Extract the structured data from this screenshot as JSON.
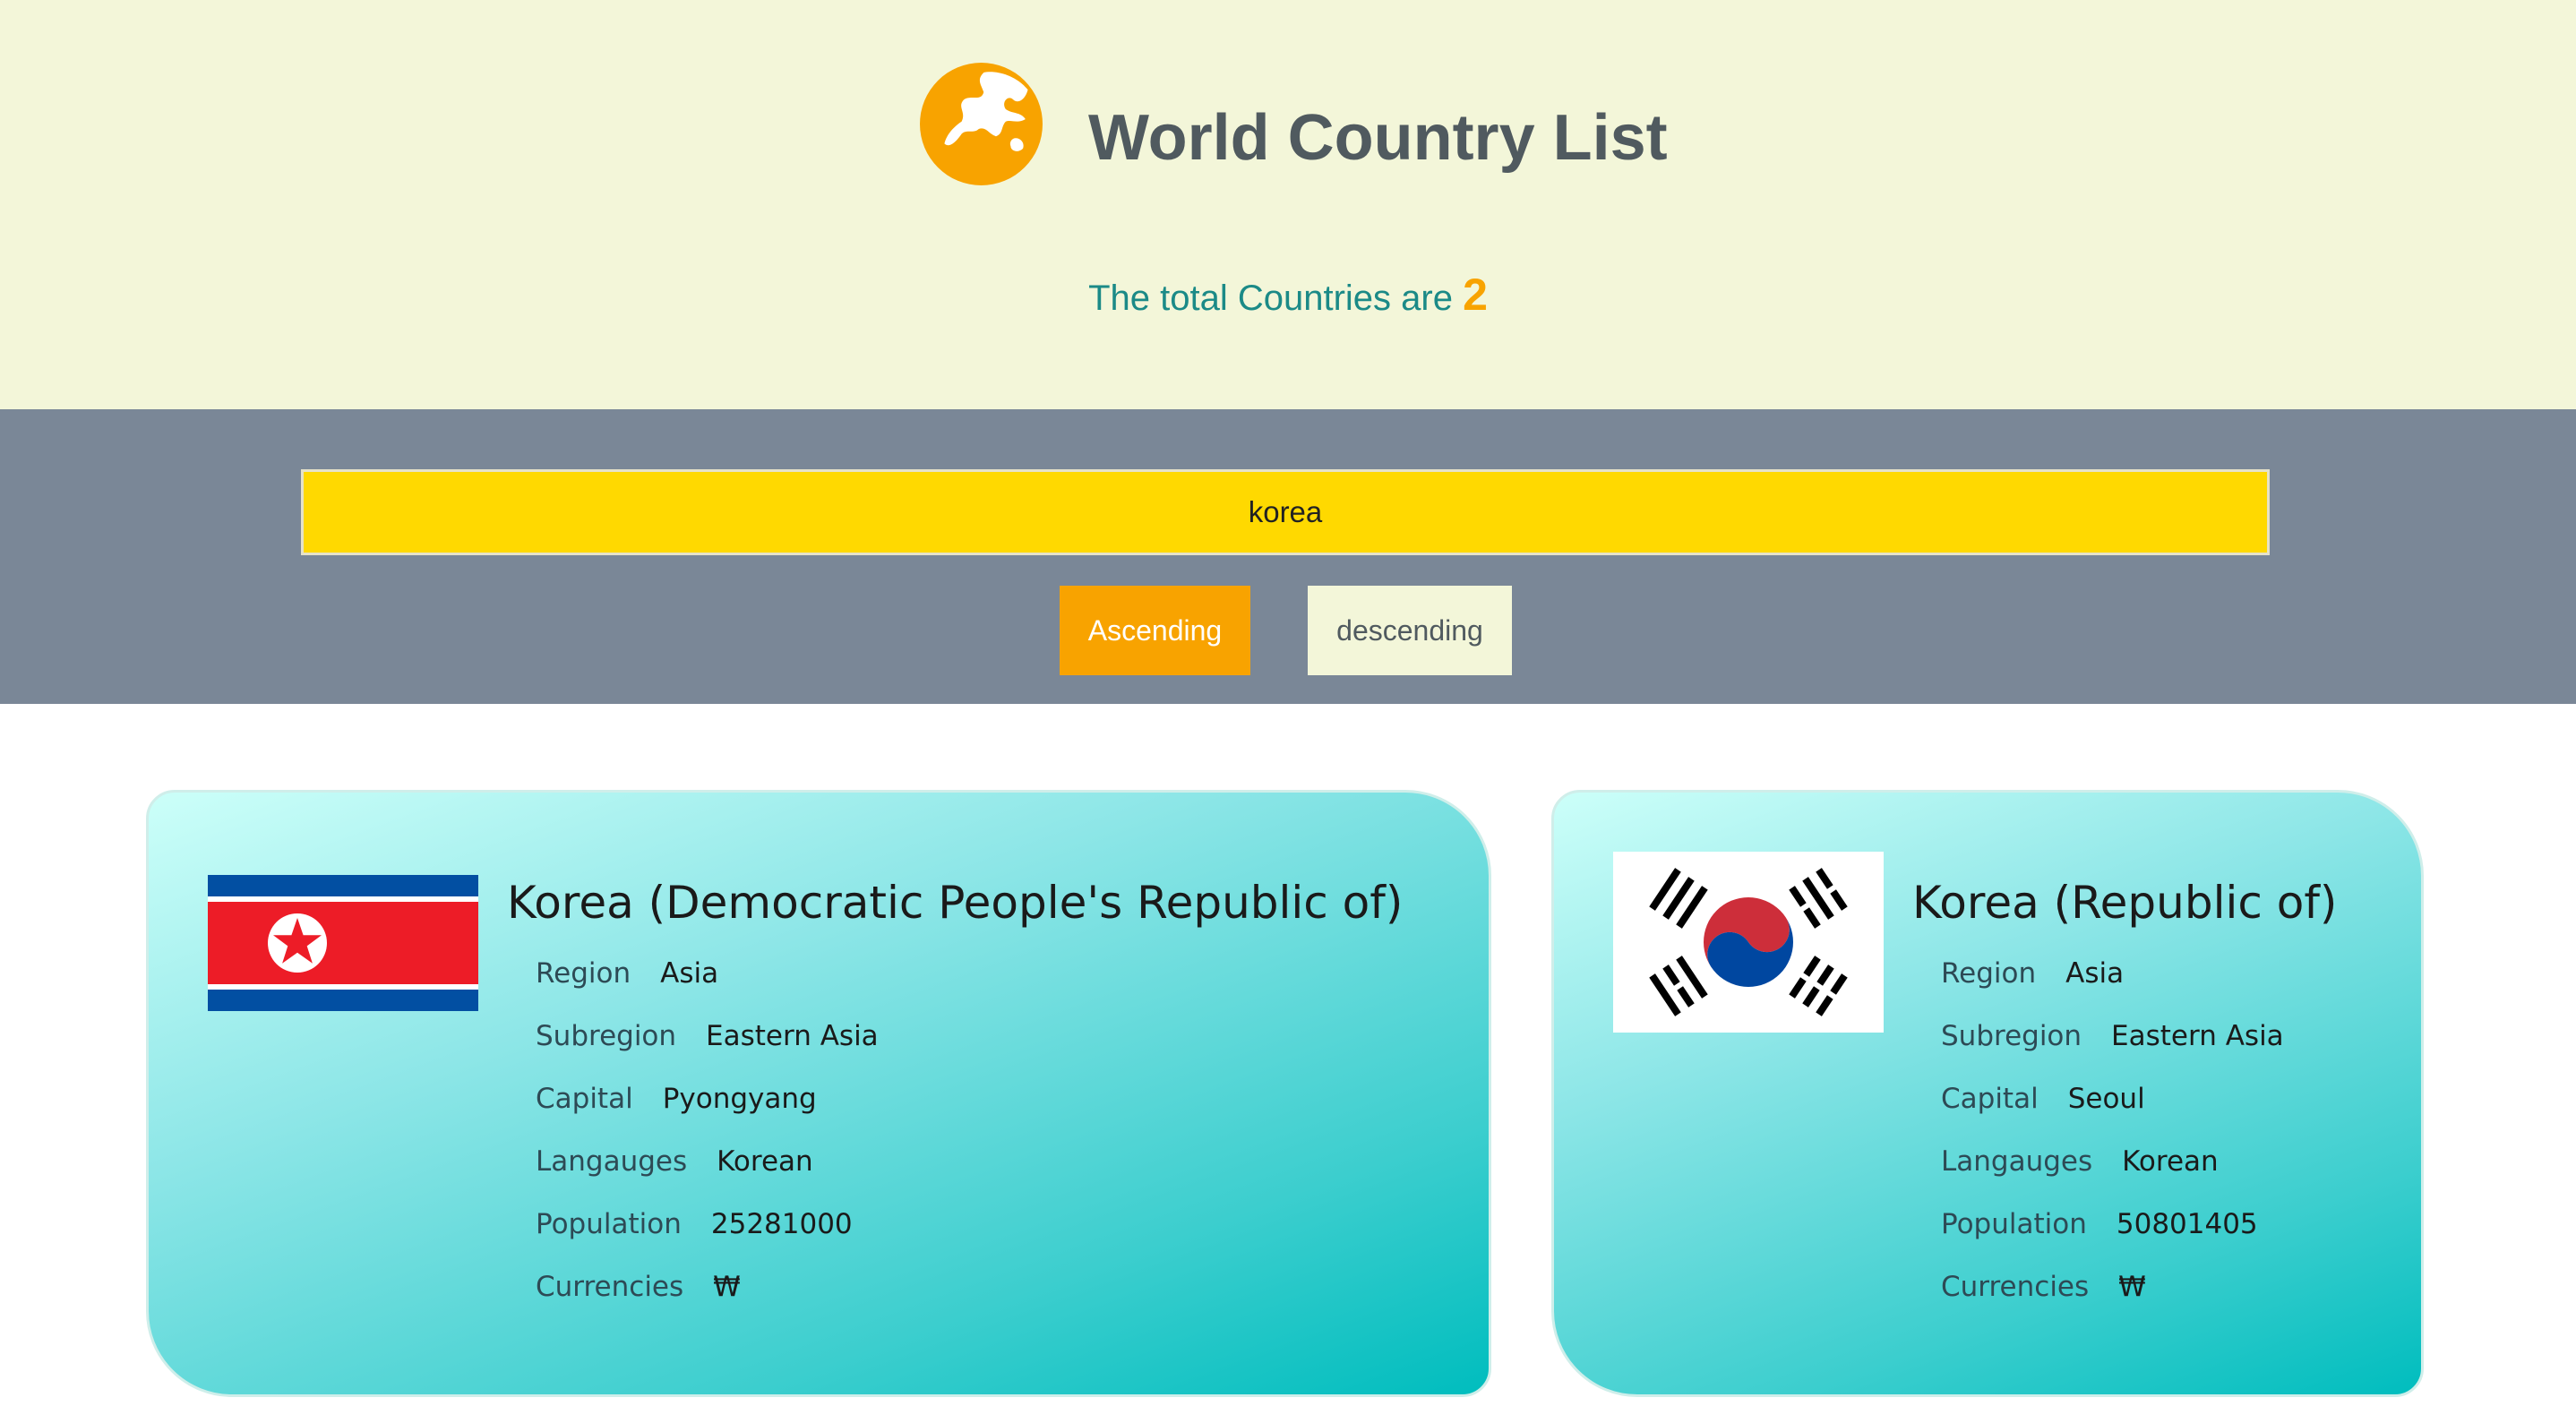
{
  "header": {
    "title": "World Country List",
    "total_prefix": "The total Countries are",
    "total_count": "2",
    "logo_icon": "globe-icon",
    "accent_color": "#f8a300"
  },
  "search": {
    "value": "korea",
    "placeholder": ""
  },
  "sort": {
    "ascending_label": "Ascending",
    "descending_label": "descending",
    "active": "ascending"
  },
  "countries": [
    {
      "name": "Korea (Democratic People's Republic of)",
      "flag_icon": "north-korea-flag-icon",
      "region_label": "Region",
      "region": "Asia",
      "subregion_label": "Subregion",
      "subregion": "Eastern Asia",
      "capital_label": "Capital",
      "capital": "Pyongyang",
      "languages_label": "Langauges",
      "languages": "Korean",
      "population_label": "Population",
      "population": "25281000",
      "currencies_label": "Currencies",
      "currencies": "₩"
    },
    {
      "name": "Korea (Republic of)",
      "flag_icon": "south-korea-flag-icon",
      "region_label": "Region",
      "region": "Asia",
      "subregion_label": "Subregion",
      "subregion": "Eastern Asia",
      "capital_label": "Capital",
      "capital": "Seoul",
      "languages_label": "Langauges",
      "languages": "Korean",
      "population_label": "Population",
      "population": "50801405",
      "currencies_label": "Currencies",
      "currencies": "₩"
    }
  ]
}
